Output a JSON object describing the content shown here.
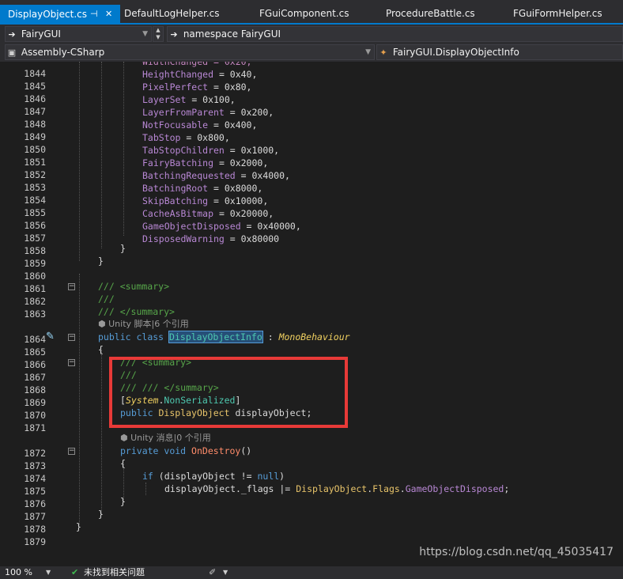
{
  "tabs": [
    {
      "label": "DisplayObject.cs",
      "pin": "⊣",
      "close": "✕",
      "active": true
    },
    {
      "label": "DefaultLogHelper.cs",
      "active": false
    },
    {
      "label": "FGuiComponent.cs",
      "active": false
    },
    {
      "label": "ProcedureBattle.cs",
      "active": false
    },
    {
      "label": "FGuiFormHelper.cs",
      "active": false
    }
  ],
  "nav": {
    "project_combo": "FairyGUI",
    "namespace_combo": "namespace FairyGUI",
    "assembly_combo": "Assembly-CSharp",
    "member_combo": "FairyGUI.DisplayObjectInfo"
  },
  "code": {
    "line_numbers": [
      "1844",
      "1845",
      "1846",
      "1847",
      "1848",
      "1849",
      "1850",
      "1851",
      "1852",
      "1853",
      "1854",
      "1855",
      "1856",
      "1857",
      "1858",
      "1859",
      "1860",
      "1861",
      "1862",
      "1863",
      "1864",
      "1865",
      "1866",
      "1867",
      "1868",
      "1869",
      "1870",
      "1871",
      "1872",
      "1873",
      "1874",
      "1875",
      "1876",
      "1877",
      "1878",
      "1879"
    ],
    "enum_lines": [
      [
        "HeightChanged",
        "0x40"
      ],
      [
        "PixelPerfect",
        "0x80"
      ],
      [
        "LayerSet",
        "0x100"
      ],
      [
        "LayerFromParent",
        "0x200"
      ],
      [
        "NotFocusable",
        "0x400"
      ],
      [
        "TabStop",
        "0x800"
      ],
      [
        "TabStopChildren",
        "0x1000"
      ],
      [
        "FairyBatching",
        "0x2000"
      ],
      [
        "BatchingRequested",
        "0x4000"
      ],
      [
        "BatchingRoot",
        "0x8000"
      ],
      [
        "SkipBatching",
        "0x10000"
      ],
      [
        "CacheAsBitmap",
        "0x20000"
      ],
      [
        "GameObjectDisposed",
        "0x40000"
      ],
      [
        "DisposedWarning",
        "0x80000"
      ]
    ],
    "summary_open": "/// <summary>",
    "summary_empty": "///",
    "summary_close": "/// </summary>",
    "codelens_class": "Unity 脚本|6 个引用",
    "class_kw1": "public",
    "class_kw2": "class",
    "class_name": "DisplayObjectInfo",
    "class_colon": ":",
    "class_base": "MonoBehaviour",
    "inner_summary_open": "/// <summary>",
    "inner_summary_empty": "///",
    "inner_summary_close": "/// /// </summary>",
    "attr_open": "[",
    "attr_ns": "System",
    "attr_dot": ".",
    "attr_name": "NonSerialized",
    "attr_close": "]",
    "field_kw": "public",
    "field_type": "DisplayObject",
    "field_name": "displayObject;",
    "codelens_method": "Unity 消息|0 个引用",
    "method_kw1": "private",
    "method_kw2": "void",
    "method_name": "OnDestroy",
    "method_parens": "()",
    "if_kw": "if",
    "if_cond_a": "(displayObject",
    "if_cond_op": "!=",
    "if_cond_b": "null",
    "if_cond_close": ")",
    "assign_a": "displayObject._flags",
    "assign_op": "|=",
    "assign_type": "DisplayObject",
    "assign_dot1": ".",
    "assign_flags": "Flags",
    "assign_dot2": ".",
    "assign_val": "GameObjectDisposed",
    "assign_end": ";",
    "brace_open": "{",
    "brace_close": "}"
  },
  "status": {
    "zoom": "100 %",
    "issues": "未找到相关问题"
  },
  "watermark": "https://blog.csdn.net/qq_45035417",
  "colors": {
    "accent": "#007acc",
    "highlight_box": "#e83a38"
  }
}
